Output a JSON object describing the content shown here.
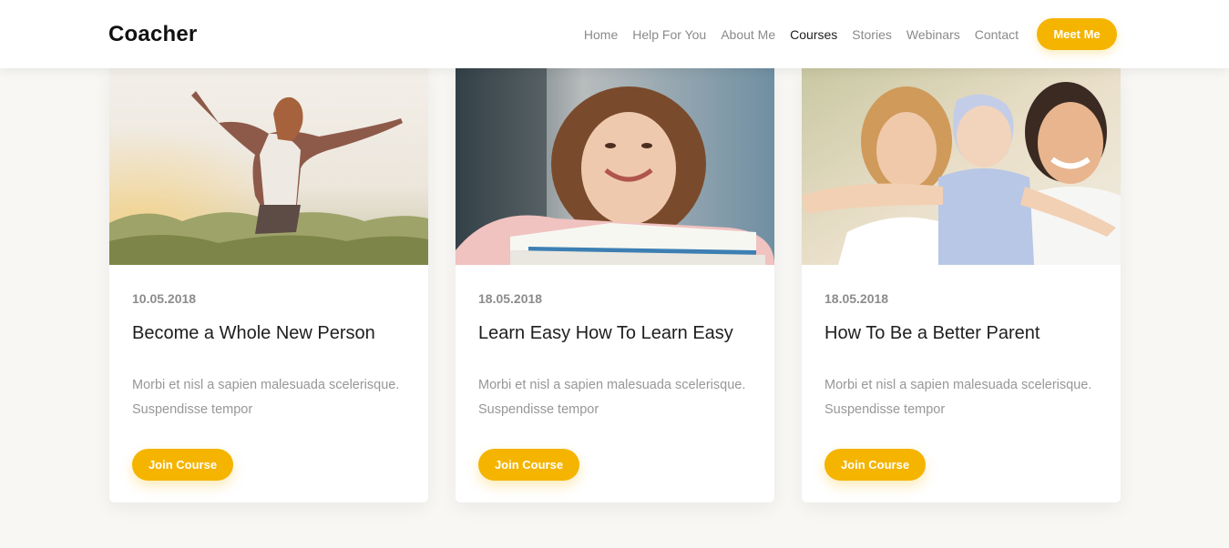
{
  "header": {
    "logo": "Coacher",
    "nav": [
      {
        "label": "Home",
        "active": false
      },
      {
        "label": "Help For You",
        "active": false
      },
      {
        "label": "About Me",
        "active": false
      },
      {
        "label": "Courses",
        "active": true
      },
      {
        "label": "Stories",
        "active": false
      },
      {
        "label": "Webinars",
        "active": false
      },
      {
        "label": "Contact",
        "active": false
      }
    ],
    "cta": "Meet Me"
  },
  "cards": [
    {
      "date": "10.05.2018",
      "title": "Become a Whole New Person",
      "text": "Morbi et nisl a sapien malesuada scelerisque. Suspendisse tempor",
      "button": "Join Course"
    },
    {
      "date": "18.05.2018",
      "title": "Learn Easy How To Learn Easy",
      "text": "Morbi et nisl a sapien malesuada scelerisque. Suspendisse tempor",
      "button": "Join Course"
    },
    {
      "date": "18.05.2018",
      "title": "How To Be a Better Parent",
      "text": "Morbi et nisl a sapien malesuada scelerisque. Suspendisse tempor",
      "button": "Join Course"
    }
  ],
  "colors": {
    "accent": "#f4b400",
    "background": "#f8f7f4",
    "text_dark": "#1e1e1e",
    "text_muted": "#979797"
  }
}
